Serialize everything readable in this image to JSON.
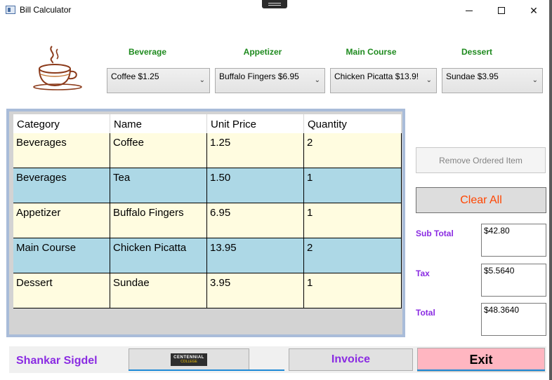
{
  "window": {
    "title": "Bill Calculator"
  },
  "menu": {
    "categories": [
      {
        "label": "Beverage",
        "selected": "Coffee    $1.25"
      },
      {
        "label": "Appetizer",
        "selected": "Buffalo Fingers    $6.95"
      },
      {
        "label": "Main Course",
        "selected": "Chicken Picatta    $13.9!"
      },
      {
        "label": "Dessert",
        "selected": "Sundae    $3.95"
      }
    ]
  },
  "order_grid": {
    "columns": [
      "Category",
      "Name",
      "Unit Price",
      "Quantity"
    ],
    "rows": [
      {
        "category": "Beverages",
        "name": "Coffee",
        "unit_price": "1.25",
        "quantity": "2"
      },
      {
        "category": "Beverages",
        "name": "Tea",
        "unit_price": "1.50",
        "quantity": "1"
      },
      {
        "category": "Appetizer",
        "name": "Buffalo Fingers",
        "unit_price": "6.95",
        "quantity": "1"
      },
      {
        "category": "Main Course",
        "name": "Chicken Picatta",
        "unit_price": "13.95",
        "quantity": "2"
      },
      {
        "category": "Dessert",
        "name": "Sundae",
        "unit_price": "3.95",
        "quantity": "1"
      }
    ]
  },
  "actions": {
    "remove_label": "Remove Ordered Item",
    "clear_label": "Clear All"
  },
  "summary": {
    "subtotal_label": "Sub Total",
    "subtotal_value": "$42.80",
    "tax_label": "Tax",
    "tax_value": "$5.5640",
    "total_label": "Total",
    "total_value": "$48.3640"
  },
  "footer": {
    "name": "Shankar Sigdel",
    "logo_line1": "CENTENNIAL",
    "logo_line2": "COLLEGE",
    "invoice_label": "Invoice",
    "exit_label": "Exit"
  },
  "colors": {
    "category_label": "#1e8a1e",
    "accent_purple": "#8a2be2",
    "clear_text": "#ff4500",
    "row_odd": "#fffce0",
    "row_even": "#add8e6",
    "exit_bg": "#ffb6c1"
  }
}
